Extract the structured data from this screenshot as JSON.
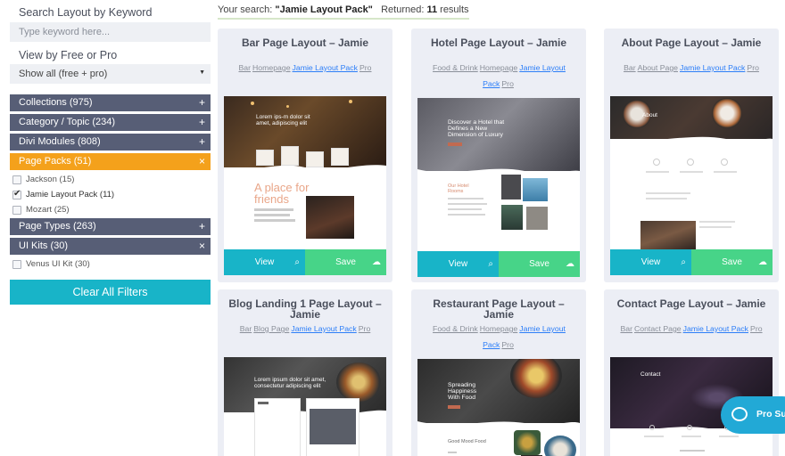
{
  "sidebar": {
    "keyword_label": "Search Layout by Keyword",
    "keyword_placeholder": "Type keyword here...",
    "free_pro_label": "View by Free or Pro",
    "free_pro_value": "Show all (free + pro)",
    "facets": [
      {
        "label": "Collections (975)",
        "toggle": "+"
      },
      {
        "label": "Category / Topic (234)",
        "toggle": "+"
      },
      {
        "label": "Divi Modules (808)",
        "toggle": "+"
      },
      {
        "label": "Page Packs (51)",
        "toggle": "×"
      },
      {
        "label": "Page Types (263)",
        "toggle": "+"
      },
      {
        "label": "UI Kits (30)",
        "toggle": "×"
      }
    ],
    "page_pack_options": [
      {
        "label": "Jackson",
        "count": "(15)",
        "checked": false
      },
      {
        "label": "Jamie Layout Pack",
        "count": "(11)",
        "checked": true
      },
      {
        "label": "Mozart",
        "count": "(25)",
        "checked": false
      }
    ],
    "ui_kit_options": [
      {
        "label": "Venus UI Kit",
        "count": "(30)",
        "checked": false
      }
    ],
    "clear_button": "Clear All Filters"
  },
  "summary": {
    "prefix": "Your search: ",
    "query": "\"Jamie Layout Pack\"",
    "returned_label": "Returned: ",
    "count": "11",
    "suffix": " results"
  },
  "cards": [
    {
      "title": "Bar Page Layout – Jamie",
      "tags": [
        "Bar",
        "Homepage",
        "Jamie Layout Pack",
        "Pro"
      ],
      "thumb_text": "Lorem ips-m dolor sit amet, adipiscing elit",
      "thumb_heading": "A place for friends"
    },
    {
      "title": "Hotel Page Layout – Jamie",
      "tags": [
        "Food & Drink",
        "Homepage",
        "Jamie Layout Pack",
        "Pro"
      ],
      "thumb_text": "Discover a Hotel that Defines a New Dimension of Luxury",
      "thumb_heading": "Our Hotel Rooms"
    },
    {
      "title": "About Page Layout – Jamie",
      "tags": [
        "Bar",
        "About Page",
        "Jamie Layout Pack",
        "Pro"
      ],
      "thumb_text": "About",
      "thumb_heading": ""
    },
    {
      "title": "Blog Landing 1 Page Layout – Jamie",
      "tags": [
        "Bar",
        "Blog Page",
        "Jamie Layout Pack",
        "Pro"
      ],
      "thumb_text": "Lorem ipsum dolor sit amet, consectetur adipiscing elit",
      "thumb_heading": ""
    },
    {
      "title": "Restaurant Page Layout – Jamie",
      "tags": [
        "Food & Drink",
        "Homepage",
        "Jamie Layout Pack",
        "Pro"
      ],
      "thumb_text": "Spreading Happiness With Food",
      "thumb_heading": "Good Mood Food"
    },
    {
      "title": "Contact Page Layout – Jamie",
      "tags": [
        "Bar",
        "Contact Page",
        "Jamie Layout Pack",
        "Pro"
      ],
      "thumb_text": "Contact",
      "thumb_heading": ""
    }
  ],
  "card_buttons": {
    "view": "View",
    "save": "Save"
  },
  "pro_support": {
    "label": "Pro Su"
  },
  "colors": {
    "facet_bg": "#575e76",
    "facet_open": "#f4a11b",
    "view_button": "#18b4c8",
    "save_button": "#47d488",
    "clear_button": "#18b4c8",
    "card_bg": "#eceef5",
    "tag_highlight": "#2c7ef8",
    "pro_support": "#22a9d6"
  },
  "icons": {
    "view": "magnifier-icon",
    "save": "cloud-download-icon",
    "select_caret": "caret-down-icon",
    "pro_support": "chat-bubble-icon"
  }
}
